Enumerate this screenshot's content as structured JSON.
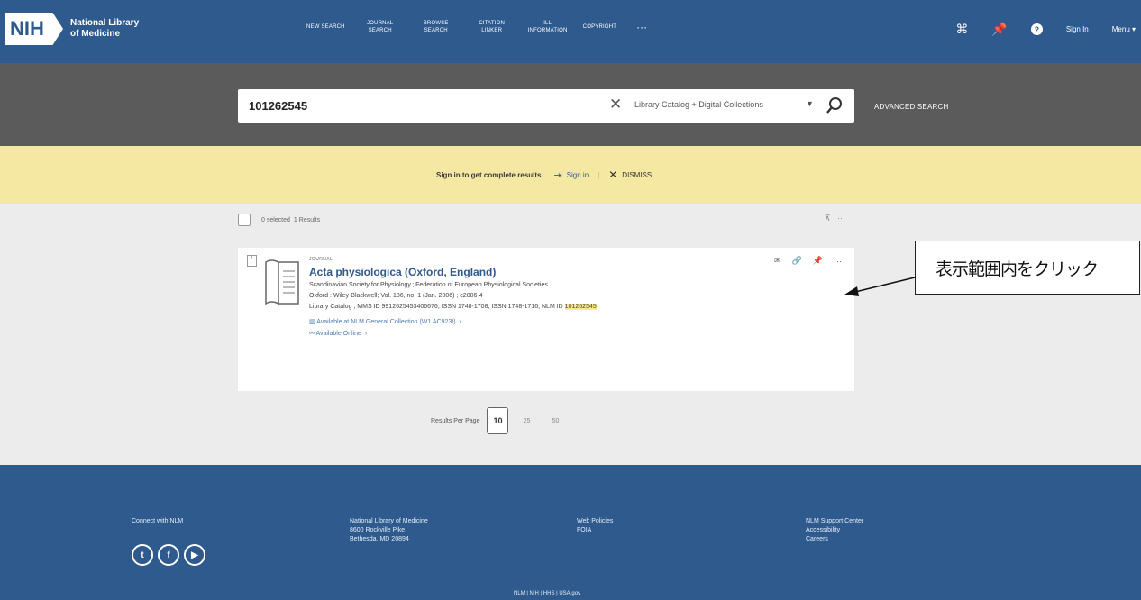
{
  "header": {
    "logo_nih": "NIH",
    "logo_text_line1": "National Library",
    "logo_text_line2": "of Medicine",
    "nav": [
      "NEW SEARCH",
      "JOURNAL SEARCH",
      "BROWSE SEARCH",
      "CITATION LINKER",
      "ILL INFORMATION",
      "COPYRIGHT"
    ],
    "nav_more": "···",
    "sign_in": "Sign In",
    "menu": "Menu ▾"
  },
  "search": {
    "query": "101262545",
    "scope": "Library Catalog + Digital Collections",
    "advanced_label": "ADVANCED SEARCH"
  },
  "notice": {
    "text": "Sign in to get complete results",
    "signin": "Sign in",
    "dismiss": "DISMISS"
  },
  "results": {
    "selected": "0 selected",
    "count": "1 Results",
    "item": {
      "type": "JOURNAL",
      "title": "Acta physiologica (Oxford, England)",
      "authors": "Scandinavian Society for Physiology.; Federation of European Physiological Societies.",
      "publication": "Oxford : Wiley-Blackwell; Vol. 186, no. 1 (Jan. 2006) ; c2006-4",
      "ids_prefix": "Library Catalog ; MMS ID 9912625453406676; ISSN 1748-1708; ISSN 1748-1716; NLM ID ",
      "nlm_id": "101262545",
      "availability": "Available at NLM General Collection (W1 AC923I)",
      "online": "Available Online"
    },
    "per_page_label": "Results Per Page",
    "per_page_options": [
      "10",
      "25",
      "50"
    ]
  },
  "footer": {
    "connect": "Connect with NLM",
    "address_line1": "National Library of Medicine",
    "address_line2": "8600 Rockville Pike",
    "address_line3": "Bethesda, MD 20894",
    "col2_line1": "Web Policies",
    "col2_line2": "FOIA",
    "col3_line1": "NLM Support Center",
    "col3_line2": "Accessibility",
    "col3_line3": "Careers",
    "links": "NLM | NIH | HHS | USA.gov"
  },
  "annotation": {
    "text": "表示範囲内をクリック"
  }
}
